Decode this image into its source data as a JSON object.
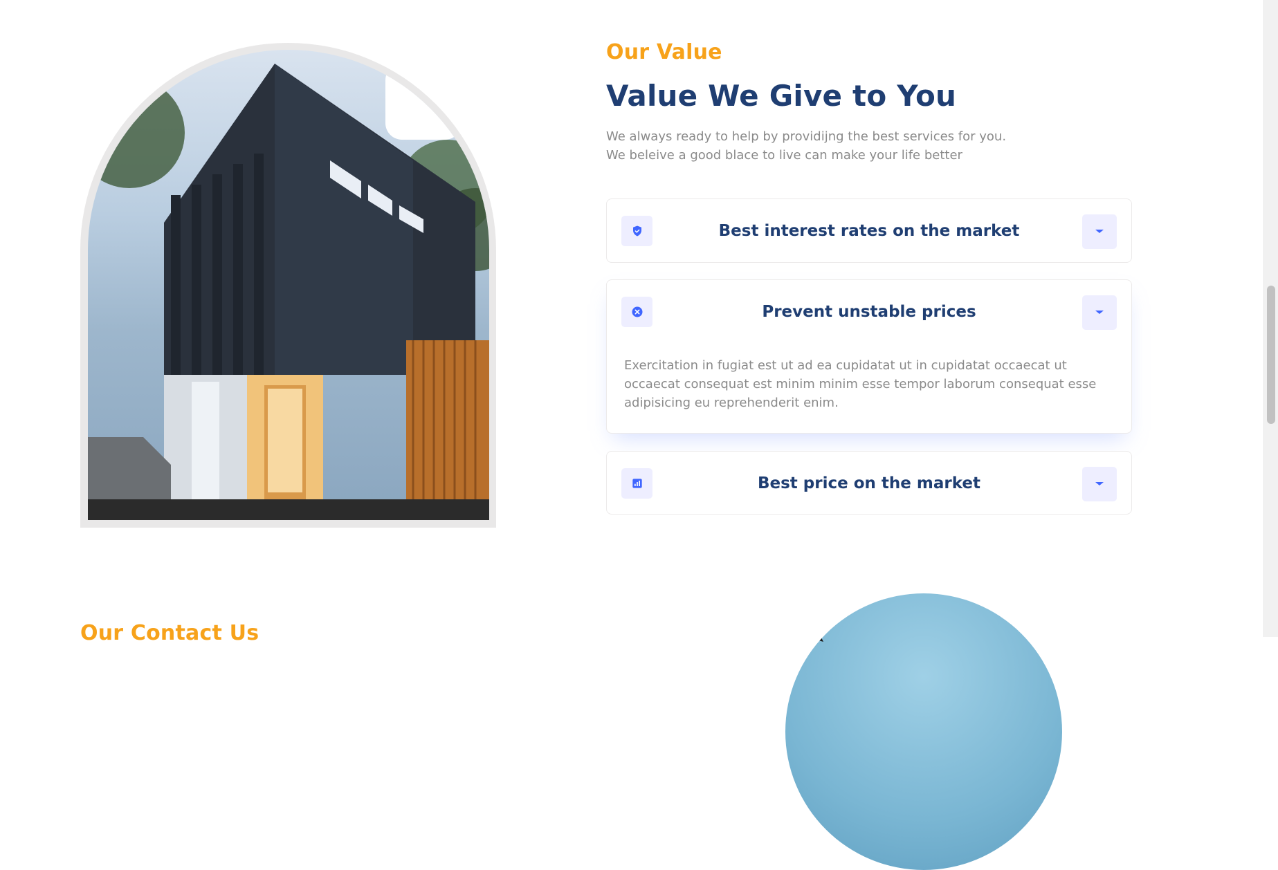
{
  "value_section": {
    "eyebrow": "Our Value",
    "title": "Value We Give to You",
    "subtitle_line1": "We always ready to help by providijng the best services for you.",
    "subtitle_line2": "We beleive a good blace to live can make your life better",
    "accordion": [
      {
        "title": "Best interest rates on the market",
        "icon": "shield-check-icon",
        "expanded": false
      },
      {
        "title": "Prevent unstable prices",
        "icon": "close-circle-icon",
        "expanded": true,
        "body": "Exercitation in fugiat est ut ad ea cupidatat ut in cupidatat occaecat ut occaecat consequat est minim minim esse tempor laborum consequat esse adipisicing eu reprehenderit enim."
      },
      {
        "title": "Best price on the market",
        "icon": "bar-chart-icon",
        "expanded": false
      }
    ]
  },
  "contact_section": {
    "eyebrow": "Our Contact Us"
  },
  "colors": {
    "accent_orange": "#f7a21a",
    "heading_blue": "#1f3e72",
    "icon_blue": "#4066ff",
    "soft_purple": "#eeeeff",
    "muted_text": "#8a8a8a"
  }
}
